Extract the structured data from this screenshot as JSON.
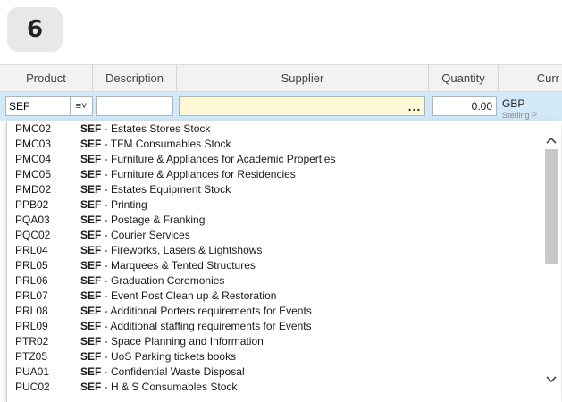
{
  "step": {
    "number": "6"
  },
  "columns": [
    "Product",
    "Description",
    "Supplier",
    "Quantity",
    "Curr"
  ],
  "filter_row": {
    "product_value": "SEF",
    "menu_icon": "≡˅",
    "supplier_button": "...",
    "quantity": "0.00",
    "currency": "GBP",
    "currency_sub": "Sterling P"
  },
  "dropdown": {
    "items": [
      {
        "code": "PMC02",
        "prefix": "SEF",
        "desc": " - Estates Stores Stock"
      },
      {
        "code": "PMC03",
        "prefix": "SEF",
        "desc": " - TFM Consumables Stock"
      },
      {
        "code": "PMC04",
        "prefix": "SEF",
        "desc": " - Furniture & Appliances for Academic Properties"
      },
      {
        "code": "PMC05",
        "prefix": "SEF",
        "desc": " - Furniture & Appliances for Residencies"
      },
      {
        "code": "PMD02",
        "prefix": "SEF",
        "desc": " - Estates Equipment Stock"
      },
      {
        "code": "PPB02",
        "prefix": "SEF",
        "desc": " - Printing"
      },
      {
        "code": "PQA03",
        "prefix": "SEF",
        "desc": " - Postage & Franking"
      },
      {
        "code": "PQC02",
        "prefix": "SEF",
        "desc": " - Courier Services"
      },
      {
        "code": "PRL04",
        "prefix": "SEF",
        "desc": " - Fireworks, Lasers & Lightshows"
      },
      {
        "code": "PRL05",
        "prefix": "SEF",
        "desc": " - Marquees & Tented Structures"
      },
      {
        "code": "PRL06",
        "prefix": "SEF",
        "desc": " - Graduation Ceremonies"
      },
      {
        "code": "PRL07",
        "prefix": "SEF",
        "desc": " - Event Post Clean up & Restoration"
      },
      {
        "code": "PRL08",
        "prefix": "SEF",
        "desc": " - Additional Porters requirements for Events"
      },
      {
        "code": "PRL09",
        "prefix": "SEF",
        "desc": " - Additional staffing requirements for Events"
      },
      {
        "code": "PTR02",
        "prefix": "SEF",
        "desc": " - Space Planning and Information"
      },
      {
        "code": "PTZ05",
        "prefix": "SEF",
        "desc": " - UoS Parking tickets books"
      },
      {
        "code": "PUA01",
        "prefix": "SEF",
        "desc": " - Confidential Waste Disposal"
      },
      {
        "code": "PUC02",
        "prefix": "SEF",
        "desc": " - H & S Consumables Stock"
      }
    ]
  },
  "colors": {
    "filter_row_bg": "#d3e9f8",
    "supplier_bg": "#fdf9d6",
    "header_bg": "#f2f2f2"
  }
}
